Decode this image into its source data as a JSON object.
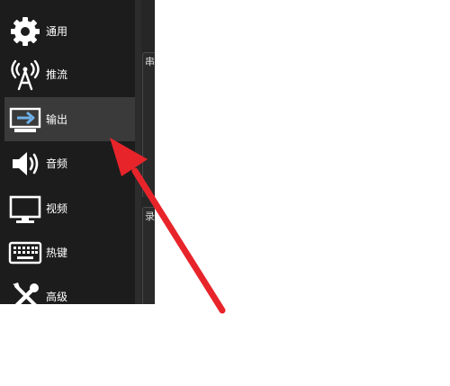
{
  "sidebar": {
    "items": [
      {
        "label": "通用",
        "icon": "gear-icon"
      },
      {
        "label": "推流",
        "icon": "broadcast-tower-icon"
      },
      {
        "label": "输出",
        "icon": "output-monitor-icon",
        "active": true
      },
      {
        "label": "音频",
        "icon": "speaker-icon"
      },
      {
        "label": "视频",
        "icon": "monitor-icon"
      },
      {
        "label": "热键",
        "icon": "keyboard-icon"
      },
      {
        "label": "高级",
        "icon": "tools-icon"
      }
    ]
  },
  "panel": {
    "tabs": [
      {
        "label": "串"
      },
      {
        "label": "录"
      }
    ]
  },
  "annotation": {
    "color": "#e8242b"
  }
}
